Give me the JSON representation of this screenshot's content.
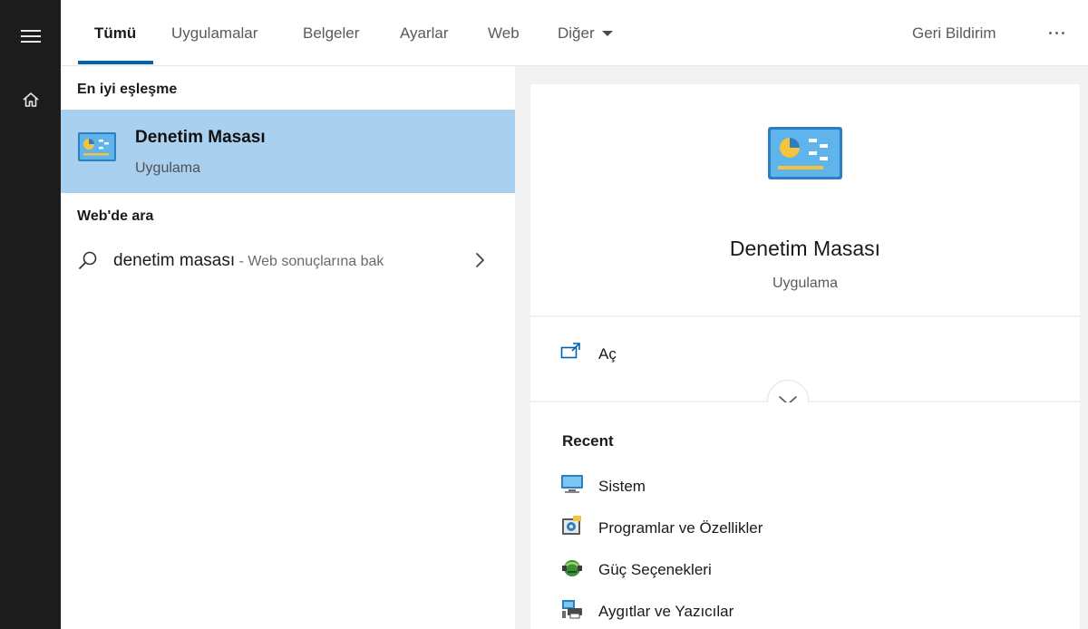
{
  "rail": {
    "icons": [
      "hamburger-menu-icon",
      "home-icon"
    ]
  },
  "tabs": [
    {
      "label": "Tümü",
      "active": true
    },
    {
      "label": "Uygulamalar",
      "active": false
    },
    {
      "label": "Belgeler",
      "active": false
    },
    {
      "label": "Ayarlar",
      "active": false
    },
    {
      "label": "Web",
      "active": false
    },
    {
      "label": "Diğer",
      "active": false,
      "dropdown": true
    }
  ],
  "topbar": {
    "feedback_label": "Geri Bildirim",
    "more_icon": "ellipsis-icon"
  },
  "results": {
    "best_match_heading": "En iyi eşleşme",
    "best_match": {
      "title": "Denetim Masası",
      "subtitle": "Uygulama",
      "icon": "control-panel-icon"
    },
    "web_heading": "Web'de ara",
    "web_item": {
      "query": "denetim masası",
      "suffix": " - Web sonuçlarına bak",
      "icon": "search-icon"
    }
  },
  "preview": {
    "title": "Denetim Masası",
    "subtitle": "Uygulama",
    "open_label": "Aç",
    "recent_heading": "Recent",
    "recent_items": [
      {
        "label": "Sistem",
        "icon": "system-monitor-icon"
      },
      {
        "label": "Programlar ve Özellikler",
        "icon": "programs-features-icon"
      },
      {
        "label": "Güç Seçenekleri",
        "icon": "power-options-icon"
      },
      {
        "label": "Aygıtlar ve Yazıcılar",
        "icon": "devices-printers-icon"
      }
    ]
  },
  "colors": {
    "accent": "#0063b1",
    "selection": "#aad0ef",
    "rail": "#1c1c1c"
  }
}
